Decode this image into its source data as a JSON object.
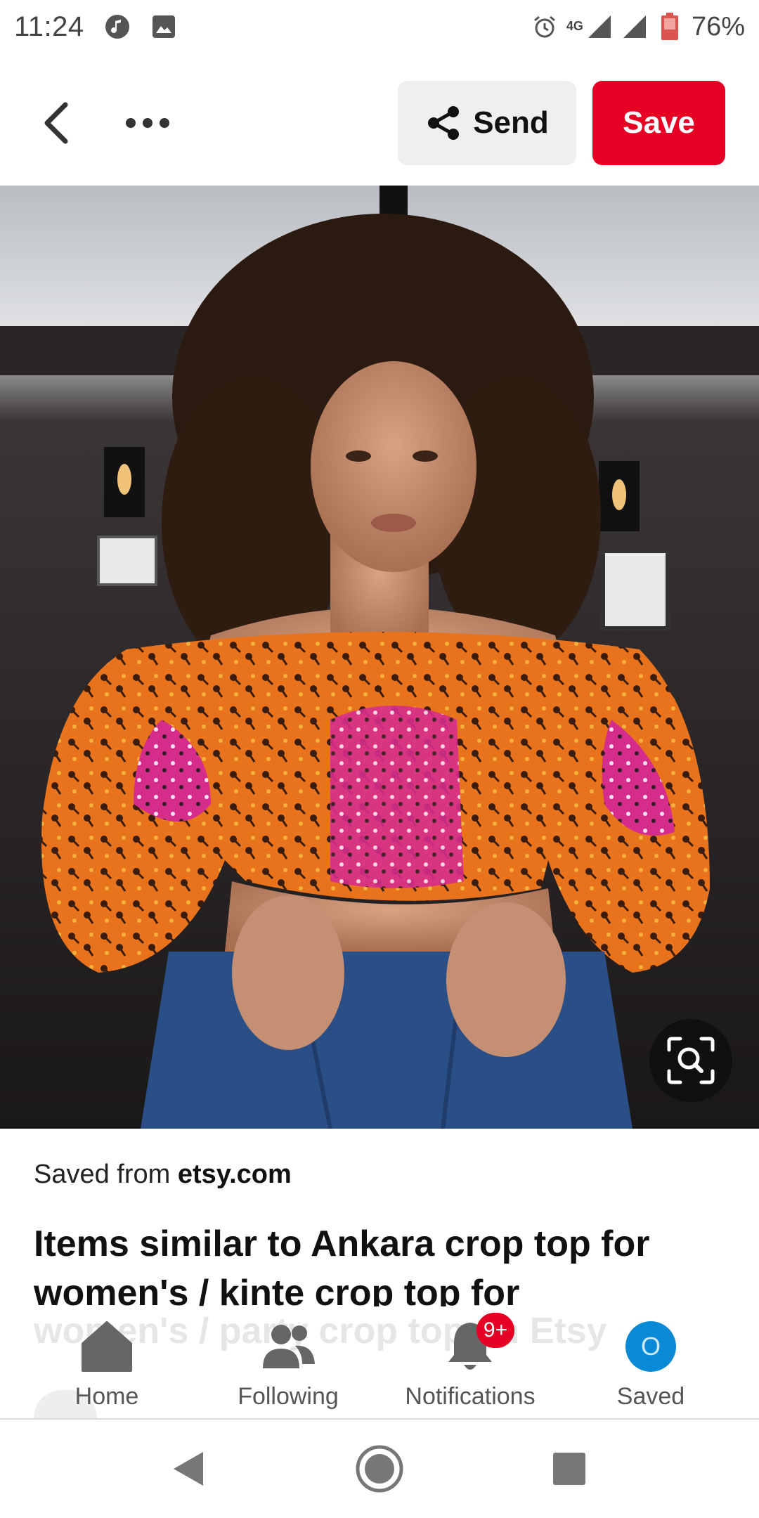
{
  "status_bar": {
    "time": "11:24",
    "network": "4G",
    "battery": "76%",
    "icons": [
      "music-icon",
      "image-icon",
      "alarm-icon",
      "signal-icon",
      "signal-icon",
      "battery-icon"
    ]
  },
  "toolbar": {
    "send_label": "Send",
    "save_label": "Save",
    "icons": [
      "back-icon",
      "more-icon",
      "share-icon"
    ]
  },
  "pin": {
    "saved_from_prefix": "Saved from",
    "source": "etsy.com",
    "title": "Items similar to Ankara crop top for women's / kinte crop top for",
    "title_faded": "women's / party crop top on Etsy"
  },
  "tabs": [
    {
      "label": "Home",
      "icon": "home-icon"
    },
    {
      "label": "Following",
      "icon": "following-icon"
    },
    {
      "label": "Notifications",
      "icon": "bell-icon",
      "badge": "9+"
    },
    {
      "label": "Saved",
      "avatar_initial": "O"
    }
  ],
  "colors": {
    "brand_red": "#e60023",
    "send_bg": "#efefef",
    "avatar_blue": "#0a8ad6"
  }
}
